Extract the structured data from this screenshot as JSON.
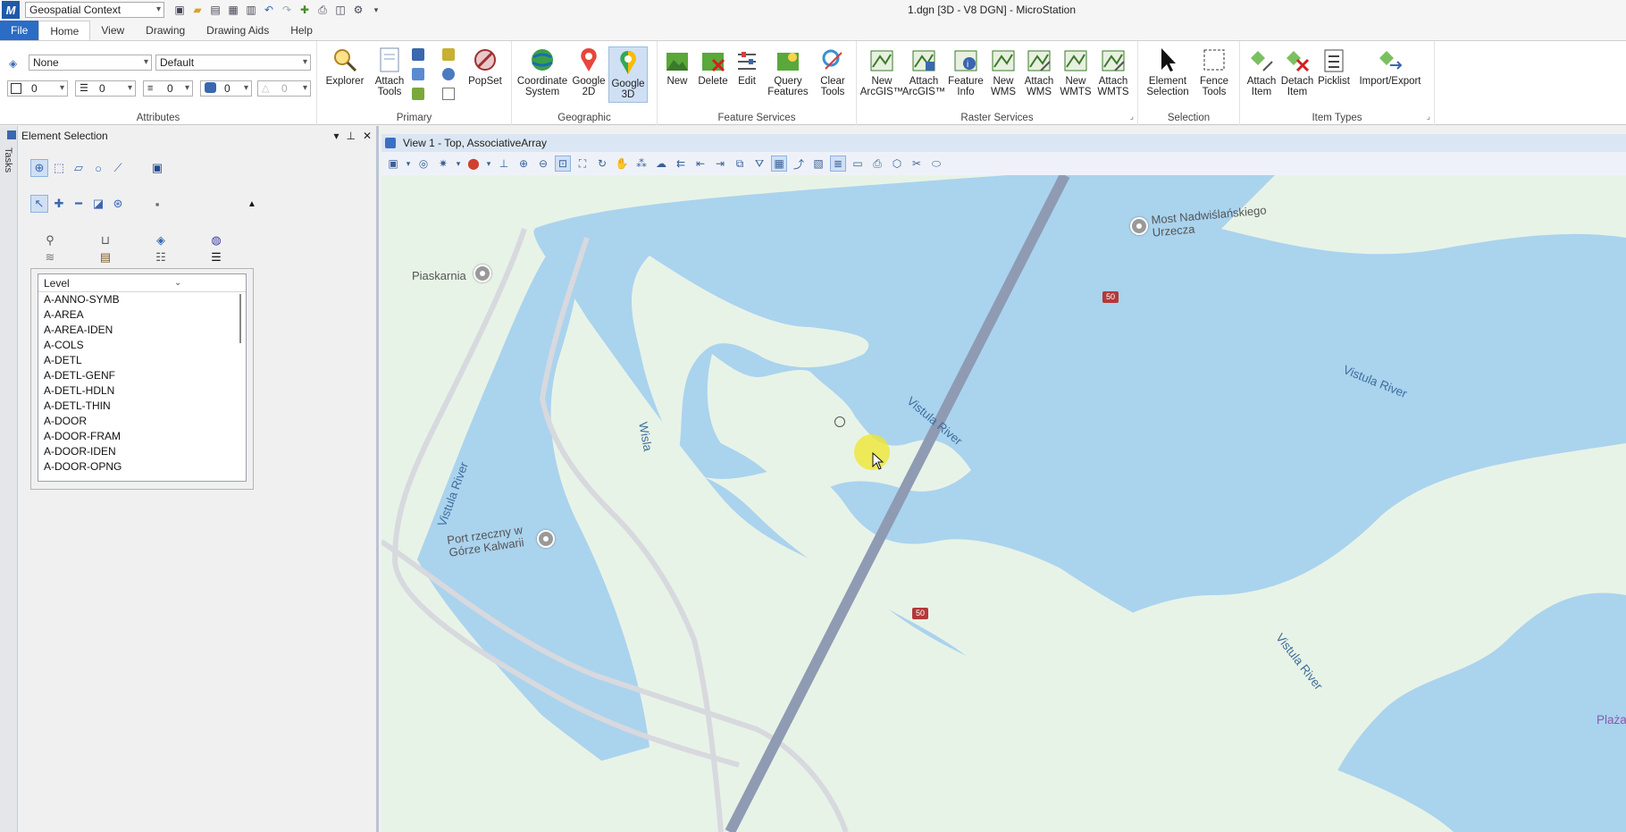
{
  "titlebar": {
    "workspace": "Geospatial Context",
    "title": "1.dgn [3D - V8 DGN] - MicroStation",
    "app_icon": "microstation-logo"
  },
  "tabs": [
    "File",
    "Home",
    "View",
    "Drawing",
    "Drawing Aids",
    "Help"
  ],
  "ribbon": {
    "attributes": {
      "label": "Attributes",
      "level_value": "None",
      "style_value": "Default",
      "color_value": "0",
      "linestyle_value": "0",
      "weight_value": "0",
      "transparency_value": "0",
      "priority_value": "0"
    },
    "primary": {
      "label": "Primary",
      "explorer": "Explorer",
      "attach_tools": "Attach\nTools",
      "popset": "PopSet"
    },
    "geographic": {
      "label": "Geographic",
      "coordinate_system": "Coordinate\nSystem",
      "google_2d": "Google\n2D",
      "google_3d": "Google\n3D"
    },
    "feature_services": {
      "label": "Feature Services",
      "new": "New",
      "delete": "Delete",
      "edit": "Edit",
      "query_features": "Query\nFeatures",
      "clear_tools": "Clear\nTools"
    },
    "raster_services": {
      "label": "Raster Services",
      "new_arcgis": "New\nArcGIS™",
      "attach_arcgis": "Attach\nArcGIS™",
      "feature_info": "Feature\nInfo",
      "new_wms": "New\nWMS",
      "attach_wms": "Attach\nWMS",
      "new_wmts": "New\nWMTS",
      "attach_wmts": "Attach\nWMTS"
    },
    "selection": {
      "label": "Selection",
      "element_selection": "Element\nSelection",
      "fence_tools": "Fence\nTools"
    },
    "item_types": {
      "label": "Item Types",
      "attach_item": "Attach\nItem",
      "detach_item": "Detach\nItem",
      "picklist": "Picklist",
      "import_export": "Import/Export"
    }
  },
  "panel": {
    "title": "Element Selection",
    "tasks_label": "Tasks",
    "list_header": "Level",
    "levels": [
      "A-ANNO-SYMB",
      "A-AREA",
      "A-AREA-IDEN",
      "A-COLS",
      "A-DETL",
      "A-DETL-GENF",
      "A-DETL-HDLN",
      "A-DETL-THIN",
      "A-DOOR",
      "A-DOOR-FRAM",
      "A-DOOR-IDEN",
      "A-DOOR-OPNG"
    ]
  },
  "view": {
    "title": "View 1 - Top, AssociativeArray"
  },
  "map": {
    "labels": {
      "vistula_1": "Vistula River",
      "vistula_2": "Vistula River",
      "vistula_3": "Vistula River",
      "vistula_4": "Vistula River",
      "wisla": "Wisla",
      "piaskarnia": "Piaskarnia",
      "port": "Port rzeczny w\nGórze Kalwarii",
      "bridge": "Most Nadwiślańskiego\nUrzecza",
      "road_50_a": "50",
      "road_50_b": "50",
      "plaza": "Plaża"
    },
    "colors": {
      "water": "#aad3ee",
      "land": "#e8f3e7",
      "road": "#8f9bb3",
      "shield": "#b23a3a"
    }
  }
}
